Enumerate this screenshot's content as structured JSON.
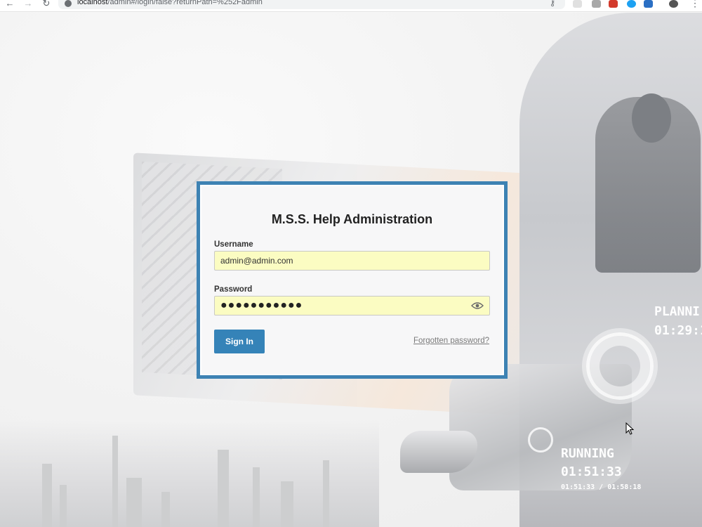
{
  "browser": {
    "url_host": "localhost",
    "url_path": "/admin#/login/false?returnPath=%252Fadmin",
    "icons": [
      "back-arrow-icon",
      "forward-arrow-icon",
      "reload-icon",
      "key-icon",
      "menu-icon"
    ]
  },
  "background": {
    "hud_planned_label": "PLANNI",
    "hud_planned_time": "01:29:1",
    "hud_running_label": "RUNNING",
    "hud_running_time": "01:51:33",
    "hud_running_sub": "01:51:33 / 01:58:18"
  },
  "login": {
    "title": "M.S.S. Help Administration",
    "username_label": "Username",
    "username_value": "admin@admin.com",
    "password_label": "Password",
    "password_masked": "●●●●●●●●●●●",
    "signin_label": "Sign In",
    "forgot_label": "Forgotten password?"
  },
  "colors": {
    "panel_border": "#3d82b3",
    "button": "#3583b8",
    "autofill": "#fbfcc2"
  }
}
